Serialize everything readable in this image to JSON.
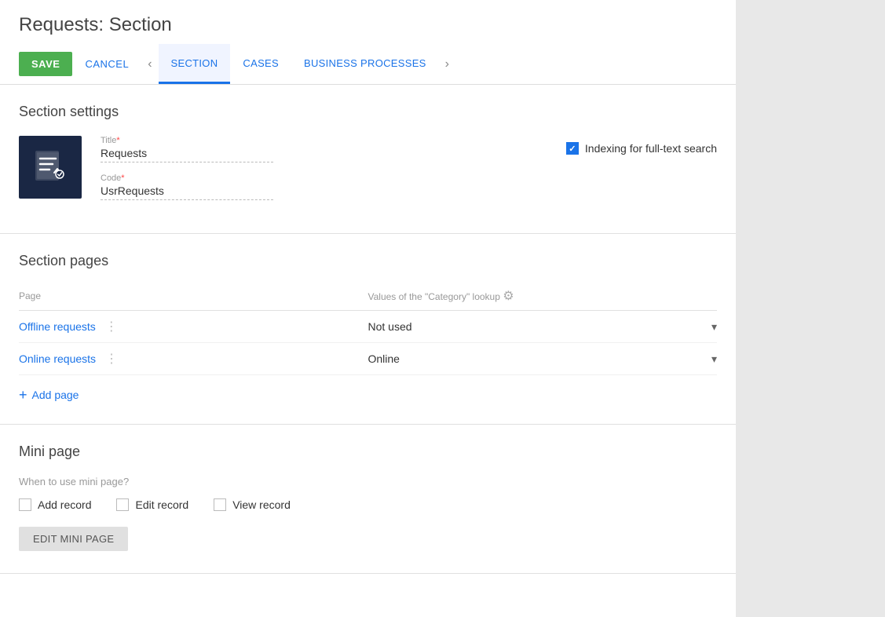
{
  "page": {
    "title": "Requests: Section"
  },
  "toolbar": {
    "save_label": "SAVE",
    "cancel_label": "CANCEL",
    "tabs": [
      {
        "id": "section",
        "label": "SECTION",
        "active": true
      },
      {
        "id": "cases",
        "label": "CASES",
        "active": false
      },
      {
        "id": "business_processes",
        "label": "BUSINESS PROCESSES",
        "active": false
      }
    ],
    "nav_prev": "‹",
    "nav_next": "›"
  },
  "section_settings": {
    "heading": "Section settings",
    "title_label": "Title",
    "title_required": "*",
    "title_value": "Requests",
    "code_label": "Code",
    "code_required": "*",
    "code_value": "UsrRequests",
    "indexing_label": "Indexing for full-text search"
  },
  "section_pages": {
    "heading": "Section pages",
    "col_page": "Page",
    "col_lookup": "Values of the \"Category\" lookup",
    "rows": [
      {
        "page": "Offline requests",
        "lookup_value": "Not used"
      },
      {
        "page": "Online requests",
        "lookup_value": "Online"
      }
    ],
    "add_page_label": "Add page"
  },
  "mini_page": {
    "heading": "Mini page",
    "question": "When to use mini page?",
    "checks": [
      {
        "id": "add_record",
        "label": "Add record",
        "checked": false
      },
      {
        "id": "edit_record",
        "label": "Edit record",
        "checked": false
      },
      {
        "id": "view_record",
        "label": "View record",
        "checked": false
      }
    ],
    "edit_button_label": "EDIT MINI PAGE"
  }
}
